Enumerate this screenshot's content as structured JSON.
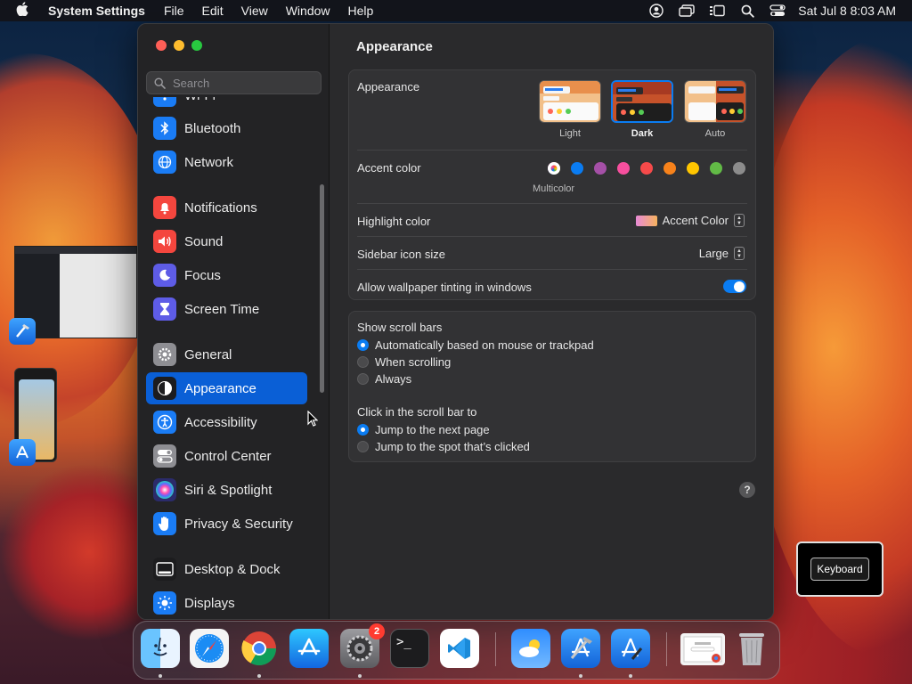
{
  "menubar": {
    "app_name": "System Settings",
    "menus": [
      "File",
      "Edit",
      "View",
      "Window",
      "Help"
    ],
    "clock": "Sat Jul 8  8:03 AM"
  },
  "sidebar": {
    "search_placeholder": "Search",
    "items": [
      {
        "label": "Wi-Fi",
        "icon": "wifi-icon",
        "color": "#1a7cf5"
      },
      {
        "label": "Bluetooth",
        "icon": "bluetooth-icon",
        "color": "#1a7cf5"
      },
      {
        "label": "Network",
        "icon": "globe-icon",
        "color": "#1a7cf5"
      },
      {
        "label": "Notifications",
        "icon": "bell-icon",
        "color": "#f4463e"
      },
      {
        "label": "Sound",
        "icon": "speaker-icon",
        "color": "#f4463e"
      },
      {
        "label": "Focus",
        "icon": "moon-icon",
        "color": "#5e5ce6"
      },
      {
        "label": "Screen Time",
        "icon": "hourglass-icon",
        "color": "#5e5ce6"
      },
      {
        "label": "General",
        "icon": "gear-icon",
        "color": "#8e8e93"
      },
      {
        "label": "Appearance",
        "icon": "appearance-icon",
        "color": "#1c1c1e",
        "active": true
      },
      {
        "label": "Accessibility",
        "icon": "accessibility-icon",
        "color": "#1a7cf5"
      },
      {
        "label": "Control Center",
        "icon": "toggles-icon",
        "color": "#8e8e93"
      },
      {
        "label": "Siri & Spotlight",
        "icon": "siri-icon",
        "color": "#2b2b6b"
      },
      {
        "label": "Privacy & Security",
        "icon": "hand-icon",
        "color": "#1a7cf5"
      },
      {
        "label": "Desktop & Dock",
        "icon": "dock-icon",
        "color": "#1c1c1e"
      },
      {
        "label": "Displays",
        "icon": "sun-icon",
        "color": "#1a7cf5"
      }
    ]
  },
  "content": {
    "title": "Appearance",
    "appearance": {
      "label": "Appearance",
      "options": [
        "Light",
        "Dark",
        "Auto"
      ],
      "selected": "Dark"
    },
    "accent": {
      "label": "Accent color",
      "selected_name": "Multicolor",
      "colors": [
        "multicolor",
        "#0a7cf2",
        "#a550a7",
        "#f74f9e",
        "#f64a4a",
        "#f7821b",
        "#ffc600",
        "#62ba46",
        "#8c8c8c"
      ]
    },
    "highlight": {
      "label": "Highlight color",
      "value": "Accent Color"
    },
    "sidebar_icon_size": {
      "label": "Sidebar icon size",
      "value": "Large"
    },
    "wallpaper_tinting": {
      "label": "Allow wallpaper tinting in windows",
      "enabled": true
    },
    "scroll_bars": {
      "label": "Show scroll bars",
      "options": [
        "Automatically based on mouse or trackpad",
        "When scrolling",
        "Always"
      ],
      "selected": 0
    },
    "click_scroll": {
      "label": "Click in the scroll bar to",
      "options": [
        "Jump to the next page",
        "Jump to the spot that’s clicked"
      ],
      "selected": 0
    },
    "help": "?"
  },
  "keyboard_hud": {
    "label": "Keyboard"
  },
  "dock": {
    "settings_badge": "2",
    "terminal_glyph": ">_"
  }
}
